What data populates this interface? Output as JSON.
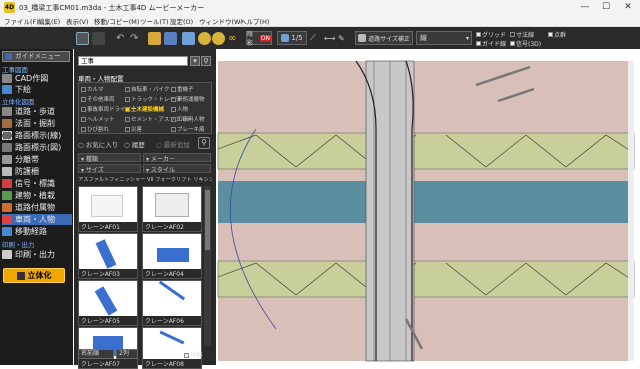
{
  "app": {
    "icon_text": "4D",
    "title": "03_橋梁工事CM01.m3da - 土木工事4D ムービーメーカー"
  },
  "window": {
    "min": "—",
    "max": "☐",
    "close": "✕"
  },
  "menu": [
    "ファイル(F)",
    "編集(E)",
    "表示(V)",
    "移動/コピー(M)",
    "ツール(T)",
    "設定(O)",
    "ウィンドウ(W)",
    "ヘルプ(H)"
  ],
  "toolbar": {
    "shade_label": "陰影",
    "shade_state": "ON",
    "scale_label": "1/5",
    "road_label": "道路サイズ補正",
    "line_label": "線",
    "grid_label": "グリッド",
    "guide_label": "ガイド線",
    "dim_label": "寸法線",
    "signal_label": "信号(3D)",
    "vertex_label": "点群"
  },
  "sidebar": {
    "top_button": "ガイドメニュー",
    "section1": "工事図面",
    "section2": "立体化図面",
    "section3": "印刷・出力",
    "items": [
      {
        "label": "CAD作図"
      },
      {
        "label": "下絵"
      },
      {
        "label": "道路・歩道"
      },
      {
        "label": "法面・掘削"
      },
      {
        "label": "路面標示(線)"
      },
      {
        "label": "路面標示(図)"
      },
      {
        "label": "分離帯"
      },
      {
        "label": "防護柵"
      },
      {
        "label": "信号・標識"
      },
      {
        "label": "建物・植栽"
      },
      {
        "label": "道路付属物"
      },
      {
        "label": "車両・人物"
      },
      {
        "label": "移動経路"
      },
      {
        "label": "印刷・出力"
      }
    ],
    "build_button": "立体化"
  },
  "panel": {
    "search_value": "工事",
    "header": "車両・人物配置",
    "categories": [
      [
        "カルマ",
        "自転車・バイク",
        "重機子"
      ],
      [
        "その他車両",
        "トラック・トレーラー",
        "車両運搬物"
      ],
      [
        "事故車両ドライバー",
        "土木建設機械",
        "人物"
      ],
      [
        "ヘルメット",
        "セメント・アスファルト",
        "工事用人物"
      ],
      [
        "ひび割れ",
        "災害",
        "ブレーキ痕"
      ]
    ],
    "filters": {
      "favorites": "お気に入り",
      "history": "履歴",
      "recent": "最新追加"
    },
    "sort": {
      "type": "種類",
      "maker": "メーカー",
      "size": "サイズ",
      "style": "スタイル"
    },
    "list_header": "アスファルトフィニッシャー VII フォークリフト リキシング",
    "thumbs": [
      "クレーンAF01",
      "クレーンAF02",
      "クレーンAF03",
      "クレーンAF04",
      "クレーンAF05",
      "クレーンAF06",
      "クレーンAF07",
      "クレーンAF08"
    ],
    "footer": {
      "name_label": "名前順",
      "col_label": "2列",
      "detail_label": "詳細"
    }
  },
  "colors": {
    "accent": "#3d6ab5",
    "build": "#f0a800",
    "ground": "#d8bfb8",
    "water": "#5b8fa0",
    "grass": "#c8cf9a"
  }
}
